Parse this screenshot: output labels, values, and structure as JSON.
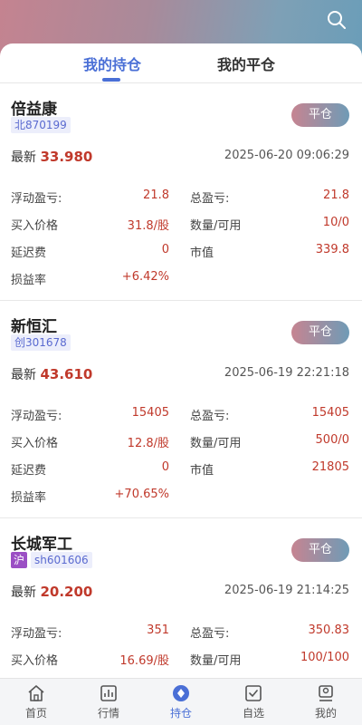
{
  "header": {
    "search_icon": "search-icon"
  },
  "tabs": [
    {
      "label": "我的持仓",
      "active": true
    },
    {
      "label": "我的平仓",
      "active": false
    }
  ],
  "labels": {
    "latest": "最新",
    "close_button": "平仓",
    "float_pl": "浮动盈亏:",
    "total_pl": "总盈亏:",
    "buy_price": "买入价格",
    "qty_avail": "数量/可用",
    "delay_fee": "延迟费",
    "market_value": "市值",
    "pl_rate": "损益率"
  },
  "positions": [
    {
      "name": "倍益康",
      "market_tag": "",
      "code": "北870199",
      "latest": "33.980",
      "time": "2025-06-20 09:06:29",
      "float_pl": "21.8",
      "total_pl": "21.8",
      "buy_price": "31.8/股",
      "qty_avail": "10/0",
      "delay_fee": "0",
      "market_value": "339.8",
      "pl_rate": "+6.42%"
    },
    {
      "name": "新恒汇",
      "market_tag": "",
      "code": "创301678",
      "latest": "43.610",
      "time": "2025-06-19 22:21:18",
      "float_pl": "15405",
      "total_pl": "15405",
      "buy_price": "12.8/股",
      "qty_avail": "500/0",
      "delay_fee": "0",
      "market_value": "21805",
      "pl_rate": "+70.65%"
    },
    {
      "name": "长城军工",
      "market_tag": "沪",
      "code": "sh601606",
      "latest": "20.200",
      "time": "2025-06-19 21:14:25",
      "float_pl": "351",
      "total_pl": "350.83",
      "buy_price": "16.69/股",
      "qty_avail": "100/100"
    }
  ],
  "nav": [
    {
      "label": "首页",
      "icon": "home-icon",
      "active": false
    },
    {
      "label": "行情",
      "icon": "chart-icon",
      "active": false
    },
    {
      "label": "持仓",
      "icon": "position-icon",
      "active": true
    },
    {
      "label": "自选",
      "icon": "checkbox-icon",
      "active": false
    },
    {
      "label": "我的",
      "icon": "profile-icon",
      "active": false
    }
  ],
  "colors": {
    "accent": "#4a6fd6",
    "price_red": "#c0392b"
  }
}
